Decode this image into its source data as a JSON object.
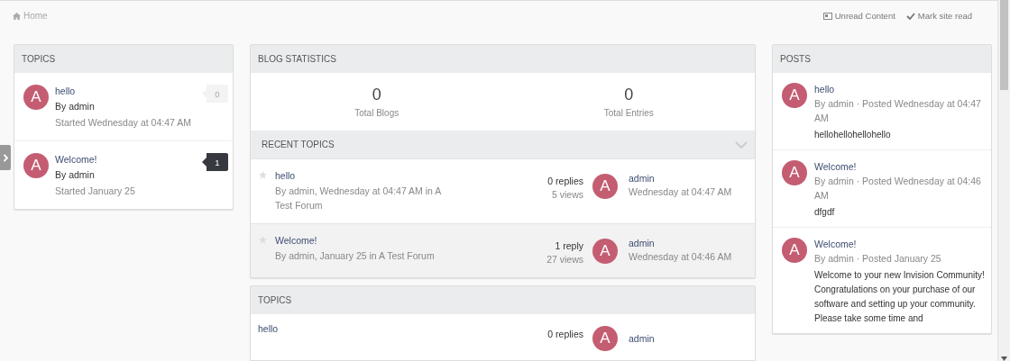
{
  "breadcrumb": {
    "label": "Home"
  },
  "top_links": [
    {
      "kind": "unread",
      "label": "Unread Content"
    },
    {
      "kind": "mark",
      "label": "Mark site read"
    }
  ],
  "topics_widget": {
    "title": "TOPICS",
    "items": [
      {
        "avatar": "A",
        "title": "hello",
        "author": "By admin",
        "started": "Started Wednesday at 04:47 AM",
        "comments": "0",
        "kind": "faded"
      },
      {
        "avatar": "A",
        "title": "Welcome!",
        "author": "By admin",
        "started": "Started January 25",
        "comments": "1",
        "kind": "dark"
      }
    ]
  },
  "blog_statistics": {
    "title": "BLOG STATISTICS",
    "stats": [
      {
        "value": "0",
        "label": "Total Blogs"
      },
      {
        "value": "0",
        "label": "Total Entries"
      }
    ]
  },
  "recent_topics": {
    "title": "RECENT TOPICS",
    "rows": [
      {
        "title": "hello",
        "meta": "By admin, Wednesday at 04:47 AM in A Test Forum",
        "replies": "0 replies",
        "views": "5 views",
        "avatar": "A",
        "last_user": "admin",
        "last_time": "Wednesday at 04:47 AM",
        "highlighted": false
      },
      {
        "title": "Welcome!",
        "meta": "By admin, January 25 in A Test Forum",
        "replies": "1 reply",
        "views": "27 views",
        "avatar": "A",
        "last_user": "admin",
        "last_time": "Wednesday at 04:46 AM",
        "highlighted": true
      }
    ]
  },
  "topics_feed": {
    "title": "TOPICS",
    "rows": [
      {
        "title": "hello",
        "replies": "0 replies",
        "avatar": "A",
        "last_user": "admin"
      }
    ]
  },
  "posts": {
    "title": "POSTS",
    "items": [
      {
        "avatar": "A",
        "title": "hello",
        "meta": "By admin · Posted Wednesday at 04:47 AM",
        "body": "hellohellohellohello"
      },
      {
        "avatar": "A",
        "title": "Welcome!",
        "meta": "By admin · Posted Wednesday at 04:46 AM",
        "body": "dfgdf"
      },
      {
        "avatar": "A",
        "title": "Welcome!",
        "meta": "By admin · Posted January 25",
        "body": "Welcome to your new Invision Community!\nCongratulations on your purchase of our software and setting up your community. Please take some time and"
      }
    ]
  }
}
